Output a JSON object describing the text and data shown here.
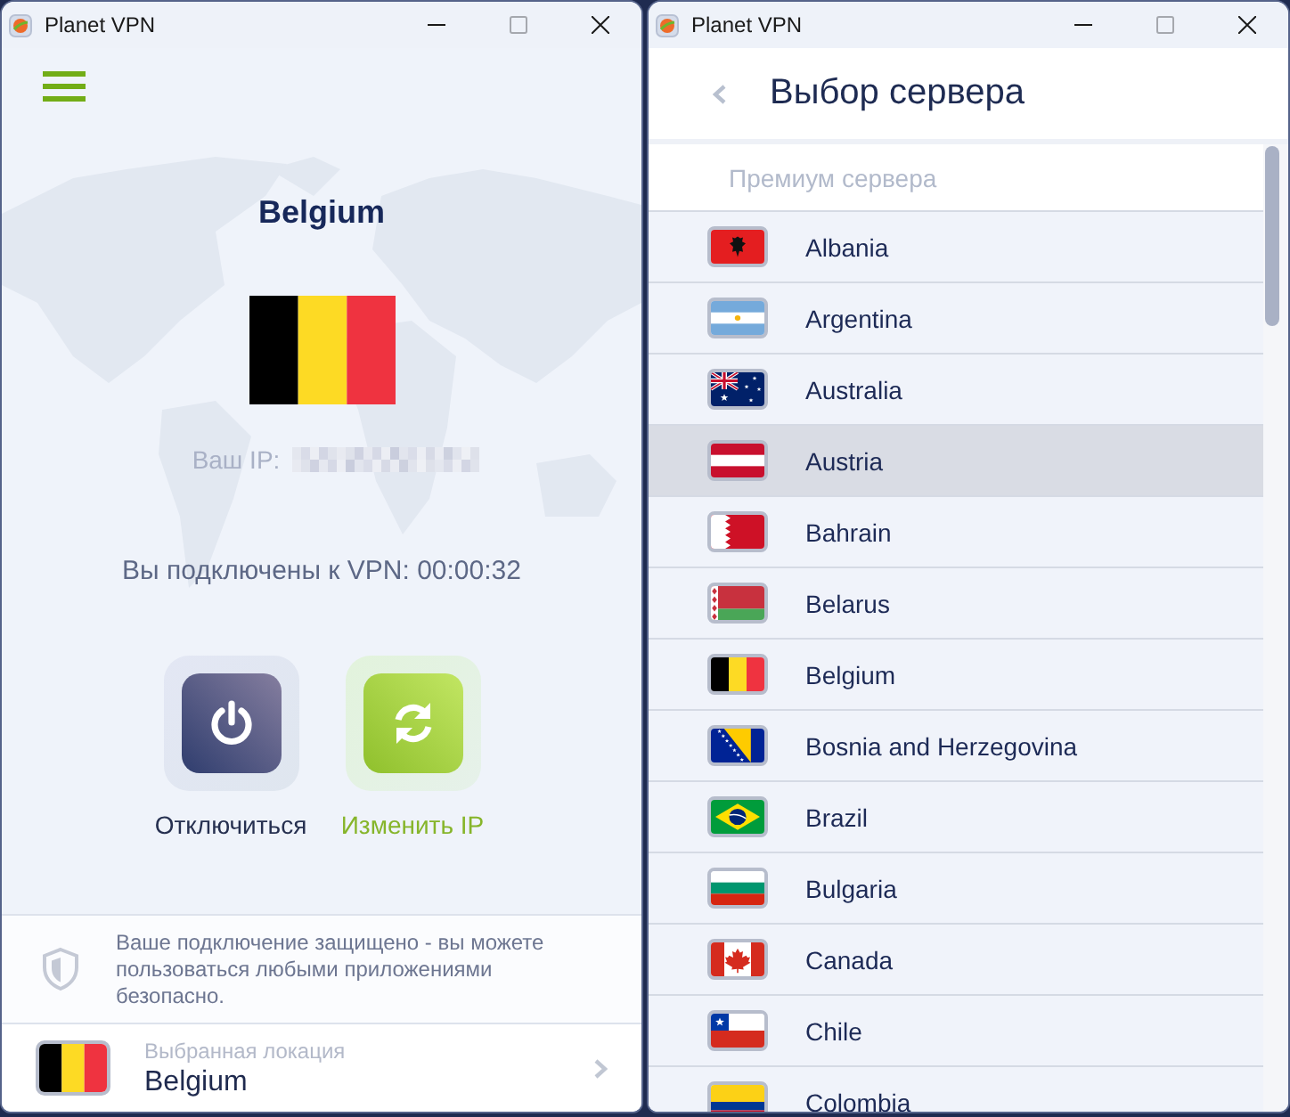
{
  "main_window": {
    "title": "Planet VPN",
    "location": {
      "country": "Belgium",
      "kind": "belgium"
    },
    "ip_label": "Ваш IP:",
    "status": "Вы подключены к VPN: 00:00:32",
    "actions": [
      {
        "kind": "disconnect",
        "label": "Отключиться"
      },
      {
        "kind": "change_ip",
        "label": "Изменить IP"
      }
    ],
    "notice": "Ваше подключение защищено - вы можете пользоваться любыми приложениями безопасно.",
    "selected_location": {
      "caption": "Выбранная локация",
      "country": "Belgium",
      "kind": "belgium"
    }
  },
  "server_window": {
    "title": "Planet VPN",
    "heading": "Выбор сервера",
    "section": "Премиум сервера",
    "servers": [
      {
        "name": "Albania",
        "kind": "albania",
        "selected": false
      },
      {
        "name": "Argentina",
        "kind": "argentina",
        "selected": false
      },
      {
        "name": "Australia",
        "kind": "australia",
        "selected": false
      },
      {
        "name": "Austria",
        "kind": "austria",
        "selected": true
      },
      {
        "name": "Bahrain",
        "kind": "bahrain",
        "selected": false
      },
      {
        "name": "Belarus",
        "kind": "belarus",
        "selected": false
      },
      {
        "name": "Belgium",
        "kind": "belgium",
        "selected": false
      },
      {
        "name": "Bosnia and Herzegovina",
        "kind": "bosnia",
        "selected": false
      },
      {
        "name": "Brazil",
        "kind": "brazil",
        "selected": false
      },
      {
        "name": "Bulgaria",
        "kind": "bulgaria",
        "selected": false
      },
      {
        "name": "Canada",
        "kind": "canada",
        "selected": false
      },
      {
        "name": "Chile",
        "kind": "chile",
        "selected": false
      },
      {
        "name": "Colombia",
        "kind": "colombia",
        "selected": false
      }
    ]
  }
}
